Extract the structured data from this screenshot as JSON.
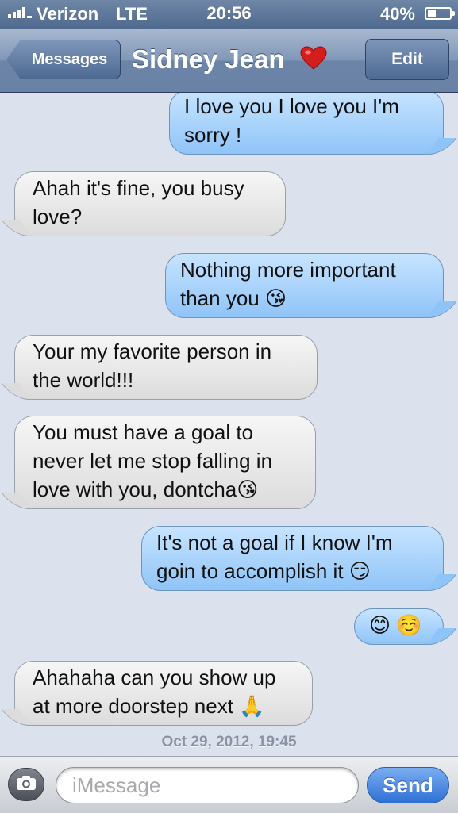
{
  "status_bar": {
    "carrier": "Verizon",
    "network": "LTE",
    "time": "20:56",
    "battery_percent_text": "40%",
    "battery_level": 0.4
  },
  "nav": {
    "back_label": "Messages",
    "title": "Sidney Jean",
    "title_icon": "heart-icon",
    "edit_label": "Edit"
  },
  "messages": [
    {
      "side": "sent",
      "text": "I love you I love you I'm sorry !"
    },
    {
      "side": "received",
      "text": "Ahah it's fine, you busy love?"
    },
    {
      "side": "sent",
      "text": "Nothing more important than you 😘"
    },
    {
      "side": "received",
      "text": "Your my favorite person in the world!!!"
    },
    {
      "side": "received",
      "text": "You must have a goal to never let me stop falling in love with you, dontcha😘"
    },
    {
      "side": "sent",
      "text": "It's not a goal if I know I'm goin to accomplish it 😏"
    },
    {
      "side": "sent",
      "text": "😊 ☺️"
    },
    {
      "side": "received",
      "text": "Ahahaha can you show up at more doorstep next 🙏"
    }
  ],
  "timestamp": "Oct 29, 2012, 19:45",
  "compose": {
    "placeholder": "iMessage",
    "send_label": "Send",
    "camera_icon": "camera-icon"
  },
  "colors": {
    "sent_bubble": "#8fc4f8",
    "received_bubble": "#dcdcdc",
    "send_button": "#2f70d6",
    "nav_bar": "#6b84a8"
  }
}
